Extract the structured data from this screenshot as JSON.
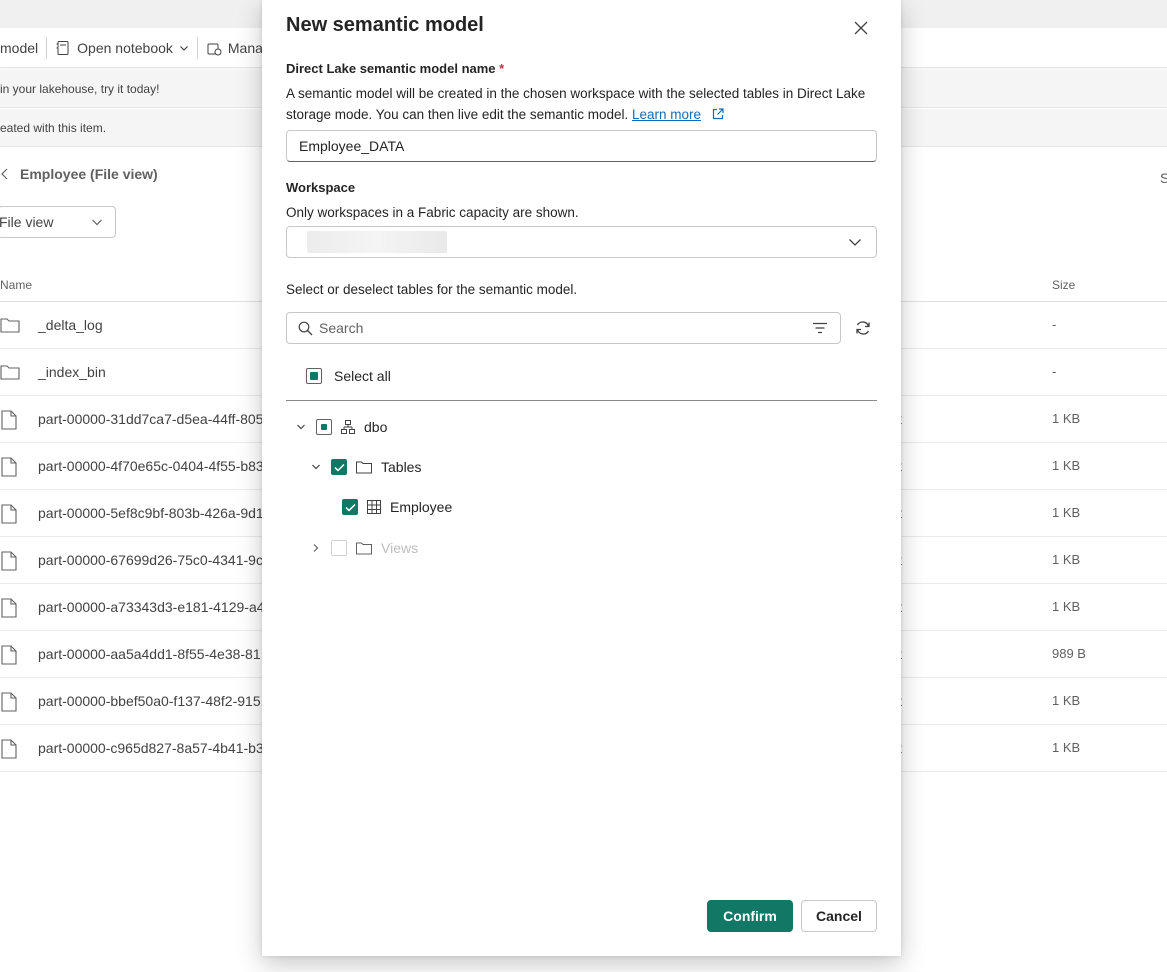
{
  "background": {
    "toolbar": {
      "item1": "model",
      "open_notebook": "Open notebook",
      "manage": "Mana"
    },
    "banner1": "in your lakehouse, try it today!",
    "banner2": "eated with this item.",
    "breadcrumb_title": "Employee (File view)",
    "right_edge_letter": "S",
    "view_selector": "File view",
    "columns": {
      "name": "Name",
      "size": "Size"
    },
    "rows": [
      {
        "name": "_delta_log",
        "type": "",
        "size": "-",
        "icon": "folder-icon"
      },
      {
        "name": "_index_bin",
        "type": "",
        "size": "-",
        "icon": "folder-icon"
      },
      {
        "name": "part-00000-31dd7ca7-d5ea-44ff-805",
        "type": "t",
        "size": "1 KB",
        "icon": "file-icon"
      },
      {
        "name": "part-00000-4f70e65c-0404-4f55-b83",
        "type": "t",
        "size": "1 KB",
        "icon": "file-icon"
      },
      {
        "name": "part-00000-5ef8c9bf-803b-426a-9d1",
        "type": "t",
        "size": "1 KB",
        "icon": "file-icon"
      },
      {
        "name": "part-00000-67699d26-75c0-4341-9c",
        "type": "t",
        "size": "1 KB",
        "icon": "file-icon"
      },
      {
        "name": "part-00000-a73343d3-e181-4129-a4",
        "type": "t",
        "size": "1 KB",
        "icon": "file-icon"
      },
      {
        "name": "part-00000-aa5a4dd1-8f55-4e38-81",
        "type": "t",
        "size": "989 B",
        "icon": "file-icon"
      },
      {
        "name": "part-00000-bbef50a0-f137-48f2-915",
        "type": "t",
        "size": "1 KB",
        "icon": "file-icon"
      },
      {
        "name": "part-00000-c965d827-8a57-4b41-b3",
        "type": "t",
        "size": "1 KB",
        "icon": "file-icon"
      }
    ]
  },
  "dialog": {
    "title": "New semantic model",
    "name_label": "Direct Lake semantic model name",
    "required_mark": "*",
    "description": "A semantic model will be created in the chosen workspace with the selected tables in Direct Lake storage mode. You can then live edit the semantic model.",
    "learn_more": "Learn more",
    "name_value": "Employee_DATA",
    "workspace_label": "Workspace",
    "workspace_hint": "Only workspaces in a Fabric capacity are shown.",
    "tables_hint": "Select or deselect tables for the semantic model.",
    "search_placeholder": "Search",
    "select_all": "Select all",
    "tree": {
      "schema": "dbo",
      "tables_folder": "Tables",
      "table": "Employee",
      "views_folder": "Views"
    },
    "confirm": "Confirm",
    "cancel": "Cancel",
    "accent_color": "#117865"
  }
}
